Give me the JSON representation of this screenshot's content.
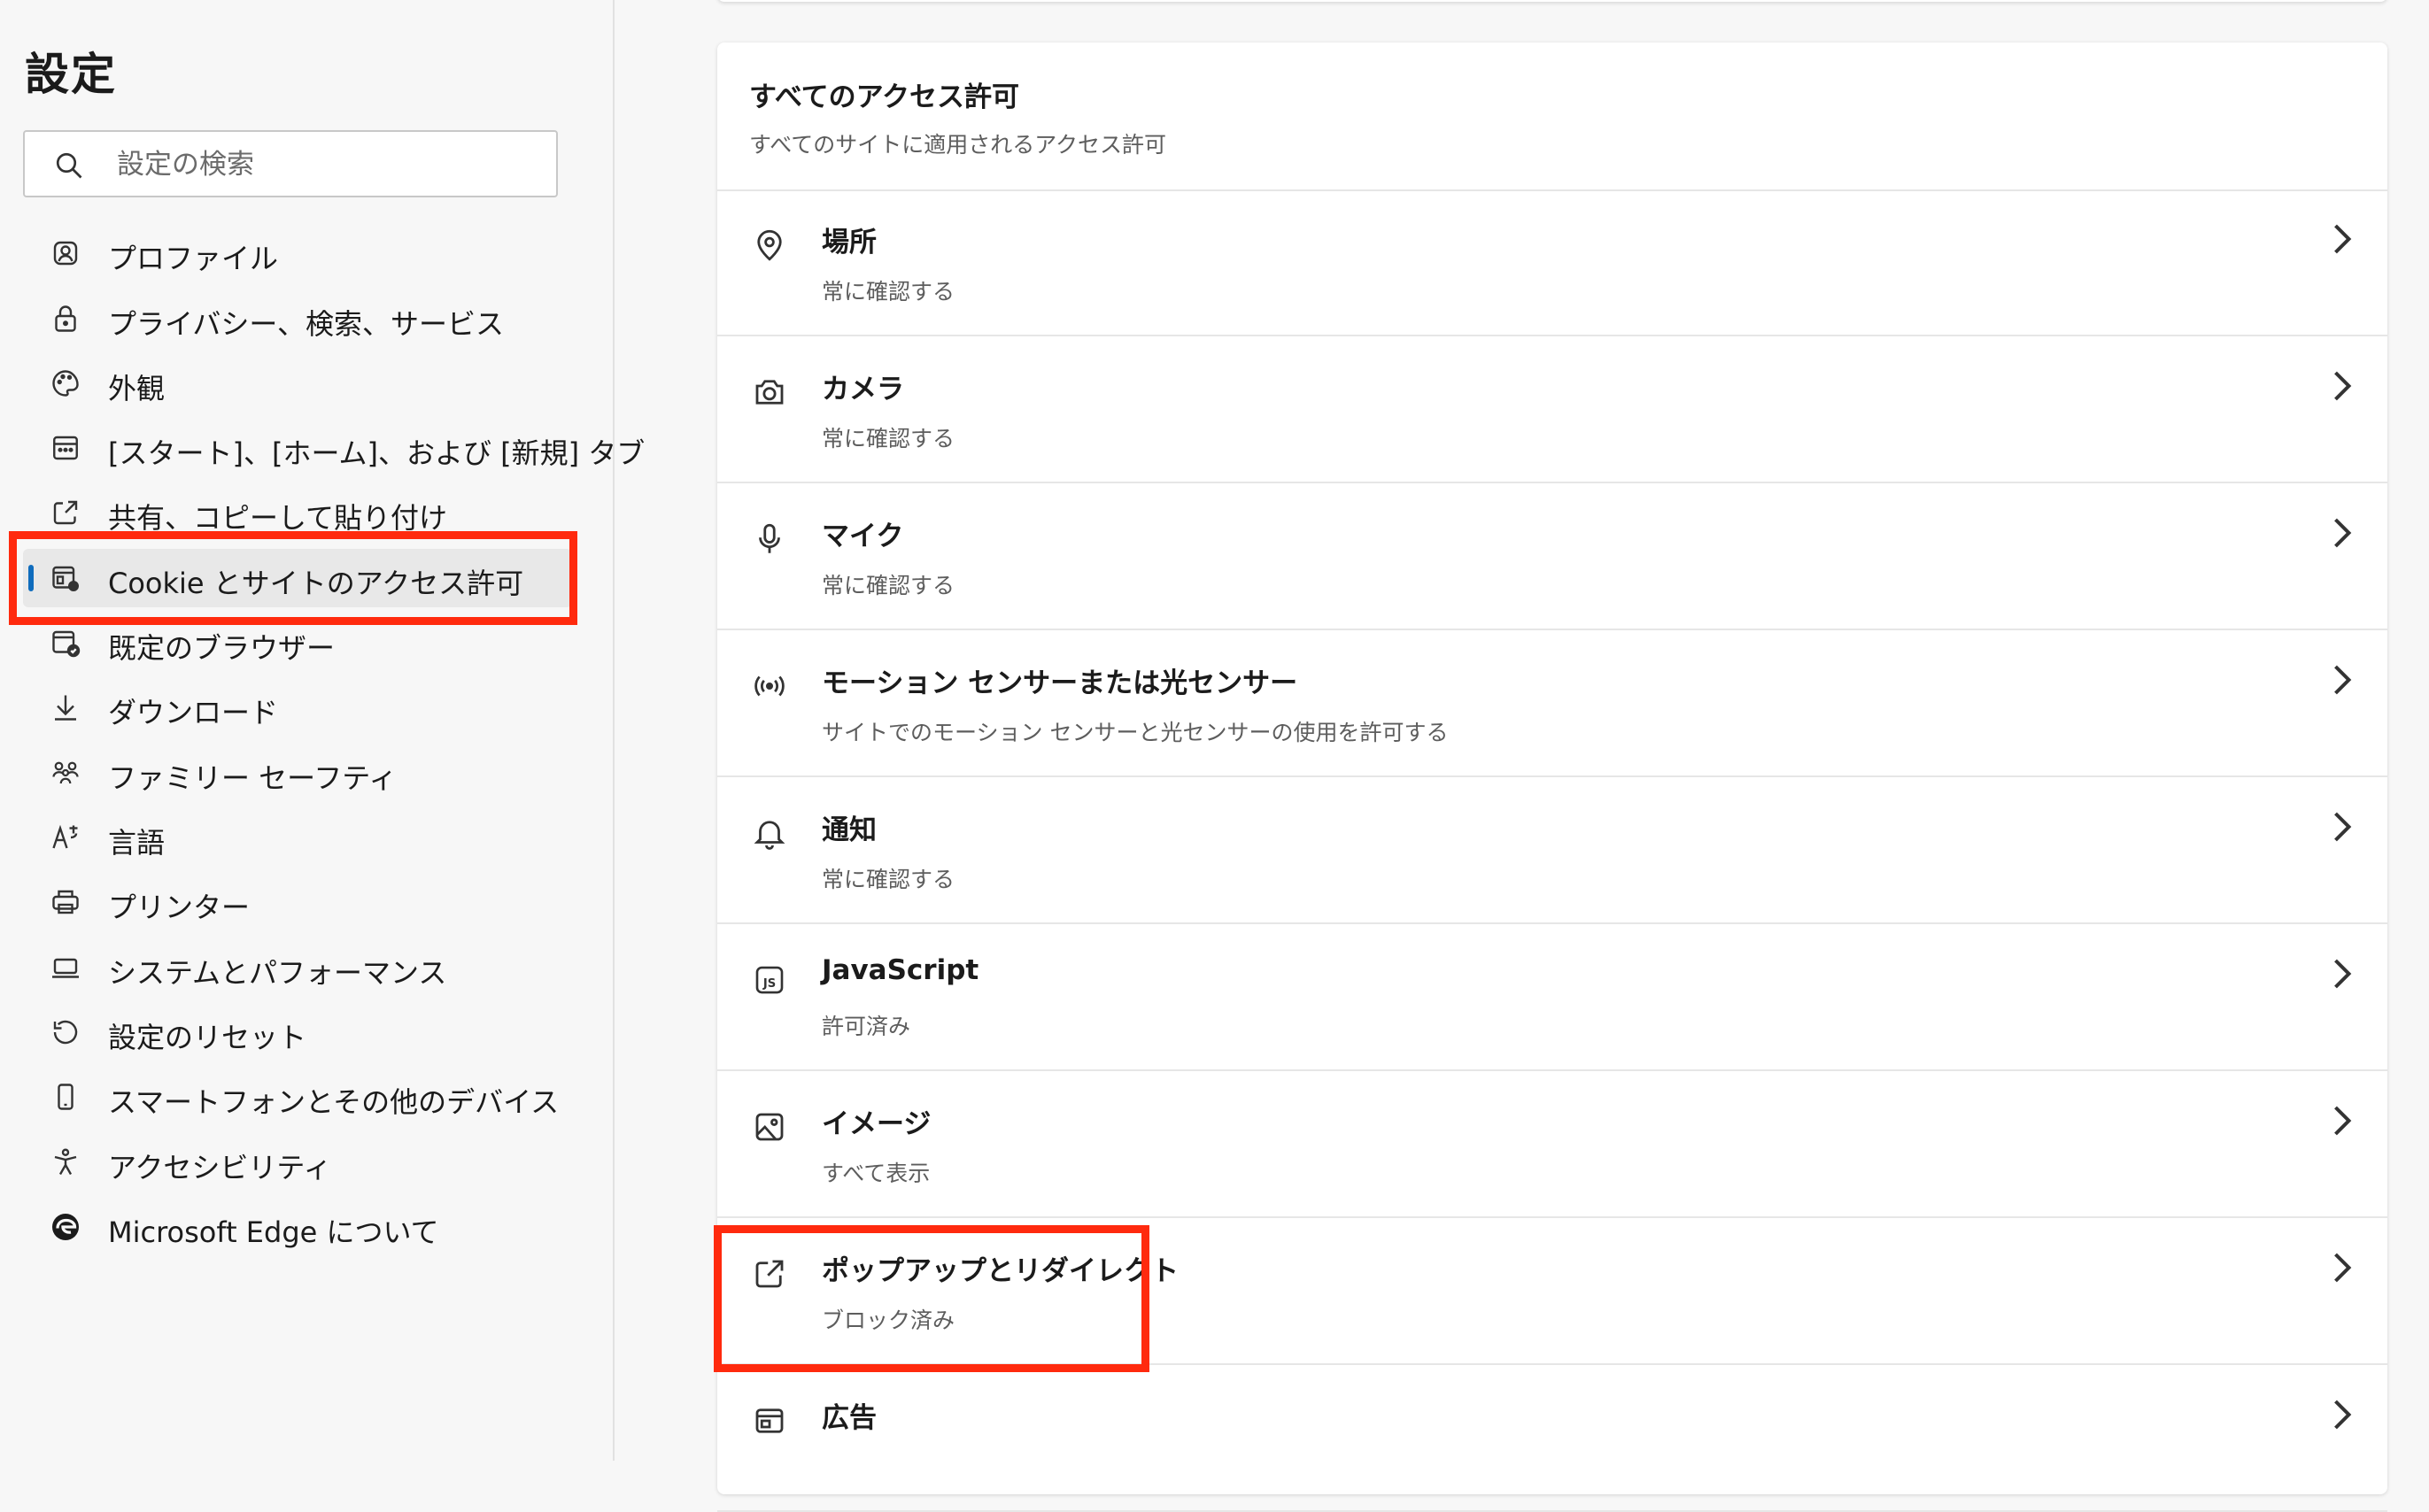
{
  "sidebar": {
    "title": "設定",
    "search_placeholder": "設定の検索",
    "items": [
      {
        "label": "プロファイル",
        "icon": "profile-icon"
      },
      {
        "label": "プライバシー、検索、サービス",
        "icon": "lock-icon"
      },
      {
        "label": "外観",
        "icon": "palette-icon"
      },
      {
        "label": "[スタート]、[ホーム]、および [新規] タブ",
        "icon": "new-tab-icon"
      },
      {
        "label": "共有、コピーして貼り付け",
        "icon": "share-icon"
      },
      {
        "label": "Cookie とサイトのアクセス許可",
        "icon": "site-permissions-icon",
        "active": true
      },
      {
        "label": "既定のブラウザー",
        "icon": "default-browser-icon"
      },
      {
        "label": "ダウンロード",
        "icon": "download-icon"
      },
      {
        "label": "ファミリー セーフティ",
        "icon": "family-icon"
      },
      {
        "label": "言語",
        "icon": "language-icon"
      },
      {
        "label": "プリンター",
        "icon": "printer-icon"
      },
      {
        "label": "システムとパフォーマンス",
        "icon": "laptop-icon"
      },
      {
        "label": "設定のリセット",
        "icon": "reset-icon"
      },
      {
        "label": "スマートフォンとその他のデバイス",
        "icon": "phone-icon"
      },
      {
        "label": "アクセシビリティ",
        "icon": "accessibility-icon"
      },
      {
        "label": "Microsoft Edge について",
        "icon": "edge-logo-icon"
      }
    ]
  },
  "permissions": {
    "title": "すべてのアクセス許可",
    "subtitle": "すべてのサイトに適用されるアクセス許可",
    "rows": [
      {
        "title": "場所",
        "description": "常に確認する",
        "icon": "location-icon"
      },
      {
        "title": "カメラ",
        "description": "常に確認する",
        "icon": "camera-icon"
      },
      {
        "title": "マイク",
        "description": "常に確認する",
        "icon": "microphone-icon"
      },
      {
        "title": "モーション センサーまたは光センサー",
        "description": "サイトでのモーション センサーと光センサーの使用を許可する",
        "icon": "motion-sensor-icon"
      },
      {
        "title": "通知",
        "description": "常に確認する",
        "icon": "bell-icon"
      },
      {
        "title": "JavaScript",
        "description": "許可済み",
        "icon": "javascript-icon"
      },
      {
        "title": "イメージ",
        "description": "すべて表示",
        "icon": "image-icon"
      },
      {
        "title": "ポップアップとリダイレクト",
        "description": "ブロック済み",
        "icon": "popup-icon"
      },
      {
        "title": "広告",
        "description": "",
        "icon": "ads-icon"
      }
    ]
  },
  "colors": {
    "highlight": "#ff2a0e",
    "active_indicator": "#0f6cbd"
  }
}
